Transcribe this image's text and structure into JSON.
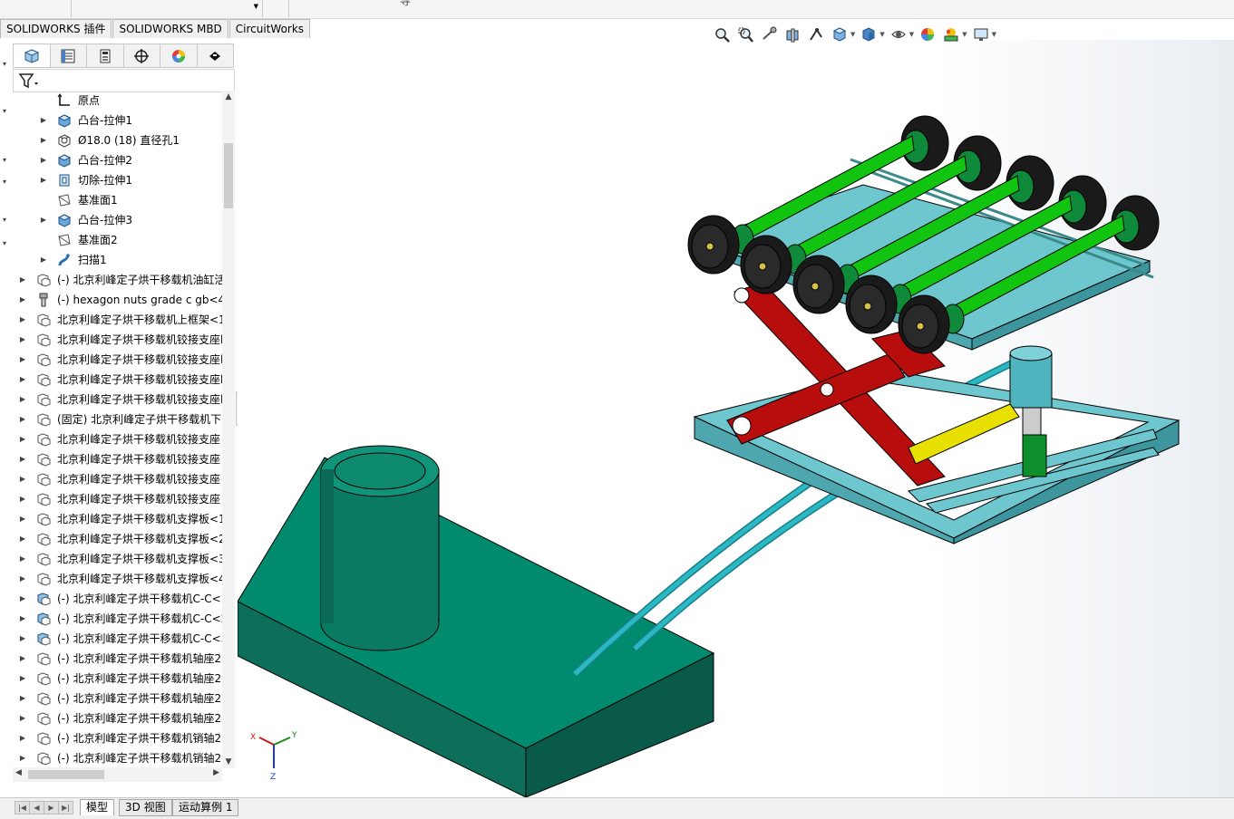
{
  "top_strip": {
    "glyph": "导"
  },
  "command_tabs": [
    "SOLIDWORKS 插件",
    "SOLIDWORKS MBD",
    "CircuitWorks"
  ],
  "feature_manager_tabs": [
    {
      "name": "featuremanager-tab",
      "icon": "part-tree-icon"
    },
    {
      "name": "propertymanager-tab",
      "icon": "property-list-icon"
    },
    {
      "name": "configurationmanager-tab",
      "icon": "configuration-icon"
    },
    {
      "name": "dimxpertmanager-tab",
      "icon": "crosshair-icon"
    },
    {
      "name": "displaymanager-tab",
      "icon": "color-wheel-icon"
    },
    {
      "name": "cam-tab",
      "icon": "black-tool-icon"
    }
  ],
  "filter": {
    "icon": "filter-icon"
  },
  "tree": [
    {
      "label": "原点",
      "icon": "origin-icon",
      "expand": false,
      "level": 1
    },
    {
      "label": "凸台-拉伸1",
      "icon": "extrude-icon",
      "expand": true,
      "level": 1
    },
    {
      "label": "Ø18.0 (18) 直径孔1",
      "icon": "hole-icon",
      "expand": true,
      "level": 1
    },
    {
      "label": "凸台-拉伸2",
      "icon": "extrude-icon",
      "expand": true,
      "level": 1
    },
    {
      "label": "切除-拉伸1",
      "icon": "cut-icon",
      "expand": true,
      "level": 1
    },
    {
      "label": "基准面1",
      "icon": "plane-icon",
      "expand": false,
      "level": 1
    },
    {
      "label": "凸台-拉伸3",
      "icon": "extrude-icon",
      "expand": true,
      "level": 1
    },
    {
      "label": "基准面2",
      "icon": "plane-icon",
      "expand": false,
      "level": 1
    },
    {
      "label": "扫描1",
      "icon": "sweep-icon",
      "expand": true,
      "level": 1
    },
    {
      "label": "(-) 北京利峰定子烘干移载机油缸活",
      "icon": "part-icon",
      "expand": true,
      "level": 0
    },
    {
      "label": "(-) hexagon nuts grade c gb<4",
      "icon": "bolt-icon",
      "expand": true,
      "level": 0
    },
    {
      "label": "北京利峰定子烘干移载机上框架<1",
      "icon": "part-icon",
      "expand": true,
      "level": 0
    },
    {
      "label": "北京利峰定子烘干移载机铰接支座l",
      "icon": "part-icon",
      "expand": true,
      "level": 0
    },
    {
      "label": "北京利峰定子烘干移载机铰接支座l",
      "icon": "part-icon",
      "expand": true,
      "level": 0
    },
    {
      "label": "北京利峰定子烘干移载机铰接支座l",
      "icon": "part-icon",
      "expand": true,
      "level": 0
    },
    {
      "label": "北京利峰定子烘干移载机铰接支座l",
      "icon": "part-icon",
      "expand": true,
      "level": 0
    },
    {
      "label": "(固定) 北京利峰定子烘干移载机下",
      "icon": "part-icon",
      "expand": true,
      "level": 0
    },
    {
      "label": "北京利峰定子烘干移载机铰接支座",
      "icon": "part-icon",
      "expand": true,
      "level": 0
    },
    {
      "label": "北京利峰定子烘干移载机铰接支座",
      "icon": "part-icon",
      "expand": true,
      "level": 0
    },
    {
      "label": "北京利峰定子烘干移载机铰接支座",
      "icon": "part-icon",
      "expand": true,
      "level": 0
    },
    {
      "label": "北京利峰定子烘干移载机铰接支座",
      "icon": "part-icon",
      "expand": true,
      "level": 0
    },
    {
      "label": "北京利峰定子烘干移载机支撑板<1",
      "icon": "part-icon",
      "expand": true,
      "level": 0
    },
    {
      "label": "北京利峰定子烘干移载机支撑板<2",
      "icon": "part-icon",
      "expand": true,
      "level": 0
    },
    {
      "label": "北京利峰定子烘干移载机支撑板<3",
      "icon": "part-icon",
      "expand": true,
      "level": 0
    },
    {
      "label": "北京利峰定子烘干移载机支撑板<4",
      "icon": "part-icon",
      "expand": true,
      "level": 0
    },
    {
      "label": "(-) 北京利峰定子烘干移载机C-C<1",
      "icon": "subassembly-icon",
      "expand": true,
      "level": 0
    },
    {
      "label": "(-) 北京利峰定子烘干移载机C-C<2",
      "icon": "subassembly-icon",
      "expand": true,
      "level": 0
    },
    {
      "label": "(-) 北京利峰定子烘干移载机C-C<3",
      "icon": "subassembly-icon",
      "expand": true,
      "level": 0
    },
    {
      "label": "(-) 北京利峰定子烘干移载机轴座2",
      "icon": "part-icon",
      "expand": true,
      "level": 0
    },
    {
      "label": "(-) 北京利峰定子烘干移载机轴座2",
      "icon": "part-icon",
      "expand": true,
      "level": 0
    },
    {
      "label": "(-) 北京利峰定子烘干移载机轴座2",
      "icon": "part-icon",
      "expand": true,
      "level": 0
    },
    {
      "label": "(-) 北京利峰定子烘干移载机轴座2",
      "icon": "part-icon",
      "expand": true,
      "level": 0
    },
    {
      "label": "(-) 北京利峰定子烘干移载机销轴2",
      "icon": "part-icon",
      "expand": true,
      "level": 0
    },
    {
      "label": "(-) 北京利峰定子烘干移载机销轴2",
      "icon": "part-icon",
      "expand": true,
      "level": 0
    }
  ],
  "bottom_tabs": [
    "模型",
    "3D 视图",
    "运动算例 1"
  ],
  "heads_up_toolbar": [
    {
      "name": "zoom-to-fit-button",
      "icon": "zoom-fit-icon",
      "dropdown": false
    },
    {
      "name": "zoom-to-area-button",
      "icon": "zoom-area-icon",
      "dropdown": false
    },
    {
      "name": "previous-view-button",
      "icon": "previous-view-icon",
      "dropdown": false
    },
    {
      "name": "section-view-button",
      "icon": "section-view-icon",
      "dropdown": false
    },
    {
      "name": "dynamic-annotation-button",
      "icon": "annotation-view-icon",
      "dropdown": false
    },
    {
      "name": "view-orientation-button",
      "icon": "view-orientation-icon",
      "dropdown": true
    },
    {
      "name": "display-style-button",
      "icon": "display-style-icon",
      "dropdown": true
    },
    {
      "name": "hide-show-items-button",
      "icon": "eye-icon",
      "dropdown": true
    },
    {
      "name": "edit-appearance-button",
      "icon": "appearance-icon",
      "dropdown": false
    },
    {
      "name": "apply-scene-button",
      "icon": "scene-icon",
      "dropdown": true
    },
    {
      "name": "view-settings-button",
      "icon": "monitor-icon",
      "dropdown": true
    }
  ],
  "triad": {
    "x": "X",
    "y": "Y",
    "z": "Z"
  },
  "colors": {
    "base_green": "#008a6e",
    "frame_cyan": "#6ec7cf",
    "scissor_red": "#b80d0d",
    "shaft_green": "#10c410",
    "roller_black": "#1a1a1a",
    "rod_yellow": "#e8e000",
    "hose_cyan": "#2ab8c4"
  }
}
